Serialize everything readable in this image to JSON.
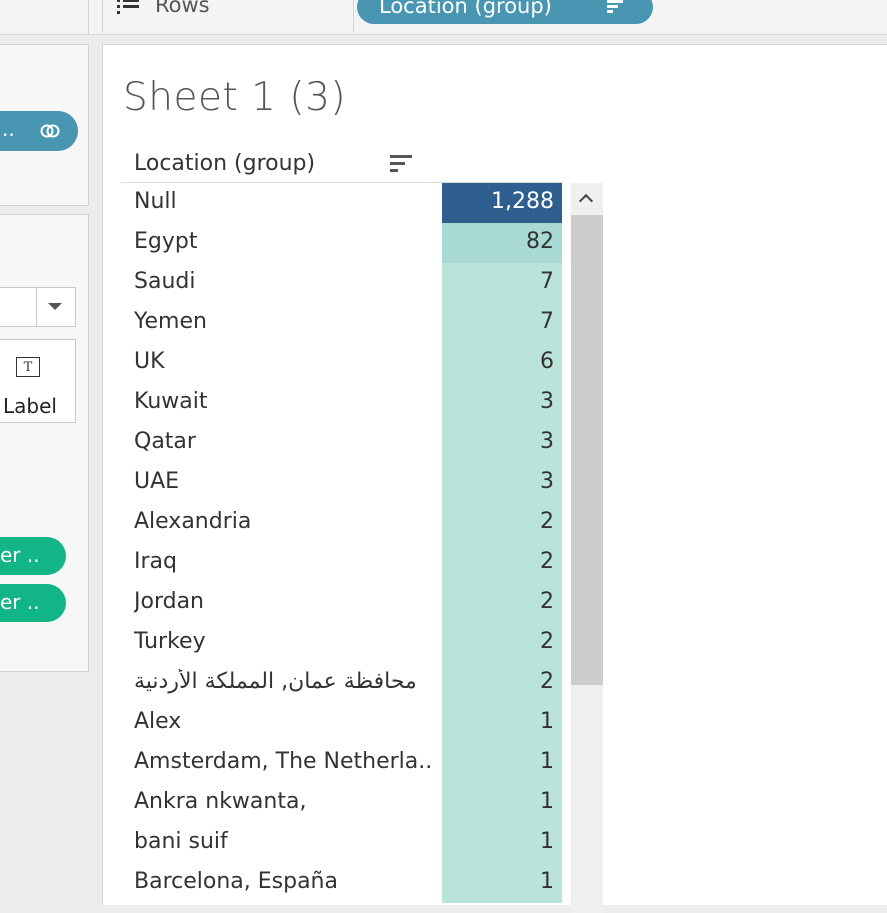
{
  "shelf": {
    "rows_label": "Rows",
    "rows_pill": "Location (group)"
  },
  "left": {
    "data_source_pill": "..",
    "label_card": "Label",
    "label_card_icon": "T",
    "filter_pills": [
      "er ..",
      "er .."
    ]
  },
  "sheet": {
    "title": "Sheet 1 (3)",
    "column_header": "Location (group)",
    "rows": [
      {
        "label": "Null",
        "value": "1,288",
        "color": "#2e5f8f",
        "text_color": "#ffffff"
      },
      {
        "label": "Egypt",
        "value": "82",
        "color": "#a9d9d5",
        "text_color": "#333333"
      },
      {
        "label": "Saudi",
        "value": "7",
        "color": "#bae3da",
        "text_color": "#333333"
      },
      {
        "label": "Yemen",
        "value": "7",
        "color": "#bae3da",
        "text_color": "#333333"
      },
      {
        "label": "UK",
        "value": "6",
        "color": "#bae3da",
        "text_color": "#333333"
      },
      {
        "label": "Kuwait",
        "value": "3",
        "color": "#bae3da",
        "text_color": "#333333"
      },
      {
        "label": "Qatar",
        "value": "3",
        "color": "#bae3da",
        "text_color": "#333333"
      },
      {
        "label": "UAE",
        "value": "3",
        "color": "#bae3da",
        "text_color": "#333333"
      },
      {
        "label": "Alexandria",
        "value": "2",
        "color": "#bae3da",
        "text_color": "#333333"
      },
      {
        "label": "Iraq",
        "value": "2",
        "color": "#bae3da",
        "text_color": "#333333"
      },
      {
        "label": "Jordan",
        "value": "2",
        "color": "#bae3da",
        "text_color": "#333333"
      },
      {
        "label": "Turkey",
        "value": "2",
        "color": "#bae3da",
        "text_color": "#333333"
      },
      {
        "label": "محافظة عمان, المملكة الأردنية",
        "value": "2",
        "color": "#bae3da",
        "text_color": "#333333"
      },
      {
        "label": "Alex",
        "value": "1",
        "color": "#bae3da",
        "text_color": "#333333"
      },
      {
        "label": "Amsterdam, The Netherla..",
        "value": "1",
        "color": "#bae3da",
        "text_color": "#333333"
      },
      {
        "label": "Ankra  nkwanta,",
        "value": "1",
        "color": "#bae3da",
        "text_color": "#333333"
      },
      {
        "label": "bani suif",
        "value": "1",
        "color": "#bae3da",
        "text_color": "#333333"
      },
      {
        "label": "Barcelona, España",
        "value": "1",
        "color": "#bae3da",
        "text_color": "#333333"
      }
    ]
  },
  "colors": {
    "pill_blue": "#4996b2",
    "pill_green": "#12b585",
    "null_bar": "#2e5f8f",
    "highlight_light": "#bae3da"
  }
}
